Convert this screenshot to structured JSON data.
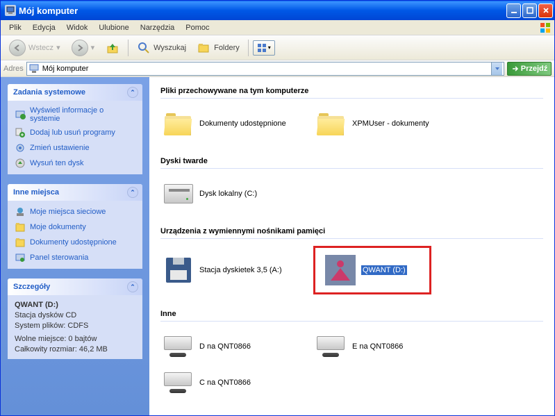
{
  "window": {
    "title": "Mój komputer"
  },
  "menubar": [
    "Plik",
    "Edycja",
    "Widok",
    "Ulubione",
    "Narzędzia",
    "Pomoc"
  ],
  "toolbar": {
    "back": "Wstecz",
    "search": "Wyszukaj",
    "folders": "Foldery"
  },
  "addressbar": {
    "label": "Adres",
    "value": "Mój komputer",
    "go": "Przejdź"
  },
  "sidebar": {
    "tasks": {
      "title": "Zadania systemowe",
      "items": [
        "Wyświetl informacje o systemie",
        "Dodaj lub usuń programy",
        "Zmień ustawienie",
        "Wysuń ten dysk"
      ]
    },
    "places": {
      "title": "Inne miejsca",
      "items": [
        "Moje miejsca sieciowe",
        "Moje dokumenty",
        "Dokumenty udostępnione",
        "Panel sterowania"
      ]
    },
    "details": {
      "title": "Szczegóły",
      "name": "QWANT (D:)",
      "type": "Stacja dysków CD",
      "fs": "System plików: CDFS",
      "free": "Wolne miejsce: 0 bajtów",
      "total": "Całkowity rozmiar: 46,2 MB"
    }
  },
  "main": {
    "sections": {
      "files": {
        "title": "Pliki przechowywane na tym komputerze",
        "items": [
          "Dokumenty udostępnione",
          "XPMUser - dokumenty"
        ]
      },
      "hdd": {
        "title": "Dyski twarde",
        "items": [
          "Dysk lokalny (C:)"
        ]
      },
      "removable": {
        "title": "Urządzenia z wymiennymi nośnikami pamięci",
        "items": [
          "Stacja dyskietek 3,5 (A:)",
          "QWANT (D:)"
        ]
      },
      "other": {
        "title": "Inne",
        "items": [
          "D na QNT0866",
          "E na QNT0866",
          "C na QNT0866"
        ]
      }
    }
  }
}
